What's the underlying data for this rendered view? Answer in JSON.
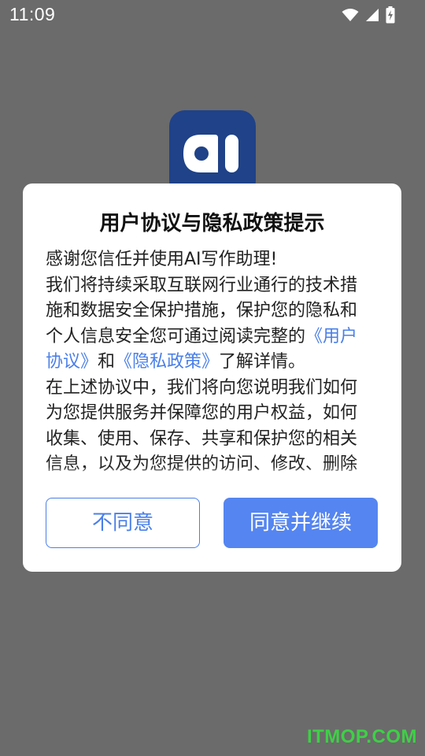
{
  "status_bar": {
    "time": "11:09"
  },
  "app_logo": {
    "text": "aI"
  },
  "dialog": {
    "title": "用户协议与隐私政策提示",
    "body": {
      "p1": "感谢您信任并使用AI写作助理!",
      "p2_before": "我们将持续采取互联网行业通行的技术措施和数据安全保护措施，保护您的隐私和个人信息安全您可通过阅读完整的",
      "user_agreement_link": "《用户协议》",
      "and_text": "和",
      "privacy_policy_link": "《隐私政策》",
      "p2_after": "了解详情。",
      "p3": "在上述协议中，我们将向您说明我们如何为您提供服务并保障您的用户权益，如何收集、使用、保存、共享和保护您的相关信息，以及为您提供的访问、修改、删除等控制方式。"
    },
    "buttons": {
      "disagree": "不同意",
      "agree": "同意并继续"
    },
    "colors": {
      "accent": "#5585f0",
      "link": "#4a7fe8"
    }
  },
  "watermark": "ITMOP.COM"
}
